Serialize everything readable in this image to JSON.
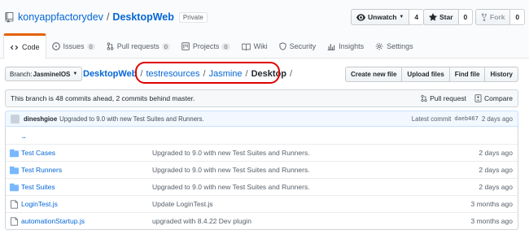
{
  "repo": {
    "owner": "konyappfactorydev",
    "separator": "/",
    "name": "DesktopWeb",
    "visibility": "Private"
  },
  "actions": {
    "watch": {
      "label": "Unwatch",
      "count": "4"
    },
    "star": {
      "label": "Star",
      "count": "0"
    },
    "fork": {
      "label": "Fork",
      "count": "0"
    }
  },
  "tabs": [
    {
      "label": "Code",
      "icon": "code-icon",
      "selected": true
    },
    {
      "label": "Issues",
      "icon": "issue-icon",
      "count": "0"
    },
    {
      "label": "Pull requests",
      "icon": "pull-request-icon",
      "count": "0"
    },
    {
      "label": "Projects",
      "icon": "project-icon",
      "count": "0"
    },
    {
      "label": "Wiki",
      "icon": "book-icon"
    },
    {
      "label": "Security",
      "icon": "shield-icon"
    },
    {
      "label": "Insights",
      "icon": "graph-icon"
    },
    {
      "label": "Settings",
      "icon": "gear-icon"
    }
  ],
  "branch": {
    "label": "Branch:",
    "name": "JasmineIOS"
  },
  "breadcrumb": {
    "root": "DesktopWeb",
    "parts": [
      "testresources",
      "Jasmine"
    ],
    "current": "Desktop",
    "sep": "/"
  },
  "file_actions": [
    "Create new file",
    "Upload files",
    "Find file",
    "History"
  ],
  "branch_info": {
    "text": "This branch is 48 commits ahead, 2 commits behind master.",
    "pull_request": "Pull request",
    "compare": "Compare"
  },
  "latest_commit": {
    "author": "dineshgioe",
    "message": "Upgraded to 9.0 with new Test Suites and Runners.",
    "label": "Latest commit",
    "sha": "daeb467",
    "time": "2 days ago"
  },
  "files": {
    "up": "..",
    "rows": [
      {
        "name": "Test Cases",
        "type": "dir",
        "message": "Upgraded to 9.0 with new Test Suites and Runners.",
        "age": "2 days ago"
      },
      {
        "name": "Test Runners",
        "type": "dir",
        "message": "Upgraded to 9.0 with new Test Suites and Runners.",
        "age": "2 days ago"
      },
      {
        "name": "Test Suites",
        "type": "dir",
        "message": "Upgraded to 9.0 with new Test Suites and Runners.",
        "age": "2 days ago"
      },
      {
        "name": "LoginTest.js",
        "type": "file",
        "message": "Update LoginTest.js",
        "age": "3 months ago"
      },
      {
        "name": "automationStartup.js",
        "type": "file",
        "message": "upgraded with 8.4.22 Dev plugin",
        "age": "3 months ago"
      }
    ]
  },
  "colors": {
    "link": "#0366d6",
    "tab_accent": "#e36209",
    "annotation": "#e00000",
    "folder": "#79b8ff"
  }
}
